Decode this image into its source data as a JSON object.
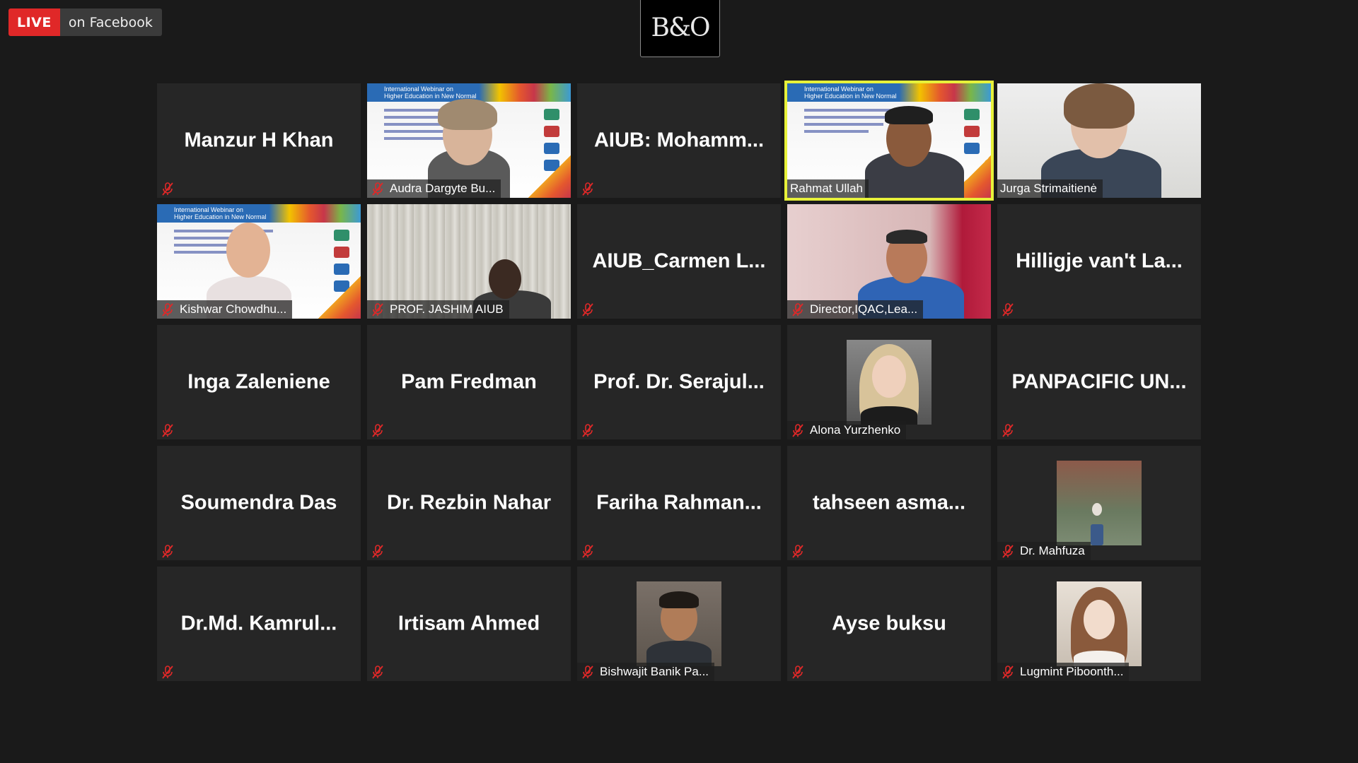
{
  "live": {
    "badge": "LIVE",
    "text": "on Facebook"
  },
  "logo": {
    "text": "B&O"
  },
  "participants": [
    {
      "big": "Manzur H Khan",
      "label": ""
    },
    {
      "big": "",
      "label": "Audra Dargyte Bu..."
    },
    {
      "big": "AIUB:  Mohamm...",
      "label": ""
    },
    {
      "big": "",
      "label": "Rahmat Ullah"
    },
    {
      "big": "",
      "label": "Jurga Strimaitienė"
    },
    {
      "big": "",
      "label": "Kishwar Chowdhu..."
    },
    {
      "big": "",
      "label": "PROF. JASHIM AIUB"
    },
    {
      "big": "AIUB_Carmen  L...",
      "label": ""
    },
    {
      "big": "",
      "label": "Director,IQAC,Lea..."
    },
    {
      "big": "Hilligje van't La...",
      "label": ""
    },
    {
      "big": "Inga Zaleniene",
      "label": ""
    },
    {
      "big": "Pam Fredman",
      "label": ""
    },
    {
      "big": "Prof.  Dr.  Serajul...",
      "label": ""
    },
    {
      "big": "",
      "label": "Alona Yurzhenko"
    },
    {
      "big": "PANPACIFIC  UN...",
      "label": ""
    },
    {
      "big": "Soumendra Das",
      "label": ""
    },
    {
      "big": "Dr. Rezbin Nahar",
      "label": ""
    },
    {
      "big": "Fariha  Rahman...",
      "label": ""
    },
    {
      "big": "tahseen  asma...",
      "label": ""
    },
    {
      "big": "",
      "label": "Dr. Mahfuza"
    },
    {
      "big": "Dr.Md.  Kamrul...",
      "label": ""
    },
    {
      "big": "Irtisam Ahmed",
      "label": ""
    },
    {
      "big": "",
      "label": "Bishwajit Banik Pa..."
    },
    {
      "big": "Ayse buksu",
      "label": ""
    },
    {
      "big": "",
      "label": "Lugmint Piboonth..."
    }
  ],
  "slide": {
    "title_small": "International Webinar on",
    "title": "Higher Education in New Normal"
  },
  "colors": {
    "background": "#1a1a1a",
    "tile": "#262626",
    "active_border": "#e7f13a",
    "live_red": "#e02828",
    "muted_mic": "#e02828"
  }
}
